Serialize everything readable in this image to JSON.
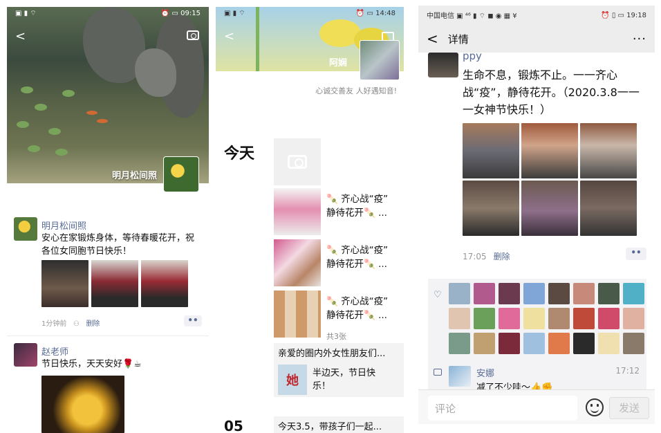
{
  "panel1": {
    "status": {
      "left": "▣ ▮ ⌔",
      "right": "⏰ ▭ 09:15"
    },
    "cover_name": "明月松间照",
    "posts": [
      {
        "name": "明月松间照",
        "text": "安心在家锻炼身体，等待春暖花开，祝各位女同胞节日快乐！",
        "time": "1分钟前",
        "delete": "删除"
      },
      {
        "name": "赵老师",
        "text": "节日快乐，天天安好🌹☕"
      }
    ],
    "more": "••"
  },
  "panel2": {
    "status": {
      "left": "▣ ▮ ⌔",
      "right": "⏰ ▭ 14:48"
    },
    "cover_name": "阿娴",
    "signature": "心诚交善友 人好遇知音!",
    "today": "今天",
    "next_date": "05",
    "feed": [
      {
        "text1": "🍡 齐心战“疫”",
        "text2": "静待花开🍡 ..."
      },
      {
        "text1": "🍡 齐心战“疫”",
        "text2": "静待花开🍡 ..."
      },
      {
        "text1": "🍡 齐心战“疫”",
        "text2": "静待花开🍡 ..."
      }
    ],
    "count_note": "共3张",
    "share": {
      "title": "亲爱的圈内外女性朋友们...",
      "thumb_text": "她",
      "text": "半边天，节日快乐！"
    },
    "bottom_share": "今天3.5，带孩子们一起..."
  },
  "panel3": {
    "status": {
      "left": "中国电信 ▣ ⁴⁶ ▮ ⌔ ◼ ◉ ▦ ¥",
      "right": "⏰ ▯ ▭ 19:18"
    },
    "back": "<",
    "title": "详情",
    "more": "···",
    "author": "ppy",
    "text": "生命不息，锻炼不止。一一齐心战“疫”，静待花开。（2020.3.8一一一女神节快乐！）",
    "time": "17:05",
    "delete": "删除",
    "dots": "••",
    "comment": {
      "name": "安娜",
      "time": "17:12",
      "text": "减了不少哇～👍✊"
    },
    "input_placeholder": "评论",
    "send": "发送"
  },
  "colors": {
    "link_blue": "#576b95",
    "meta_grey": "#999999",
    "bar_bg": "#ededed"
  }
}
